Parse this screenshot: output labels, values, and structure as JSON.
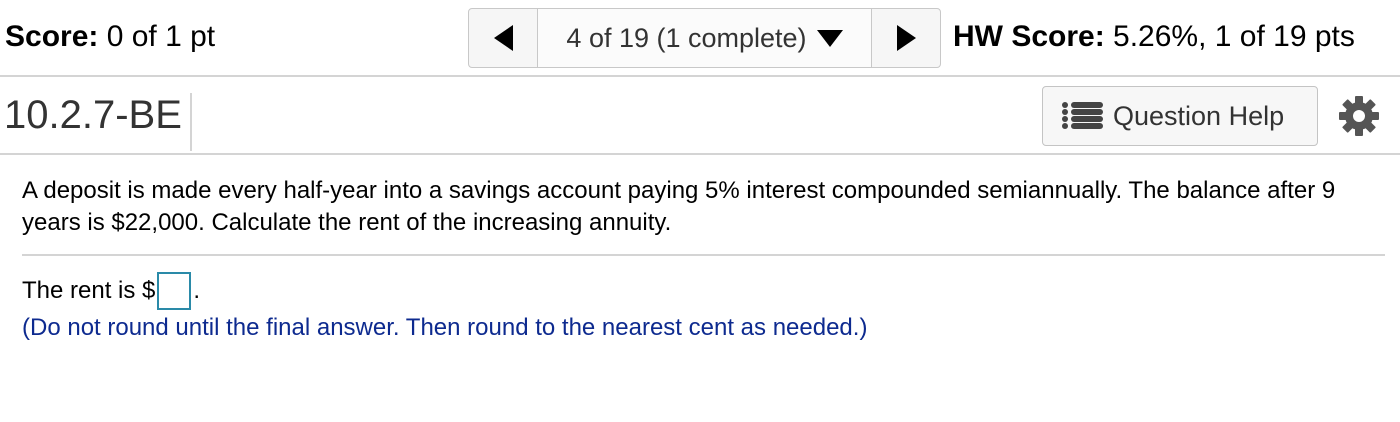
{
  "header": {
    "score_label": "Score:",
    "score_value": "0 of 1 pt",
    "nav_position": "4 of 19 (1 complete)",
    "hw_score_label": "HW Score:",
    "hw_score_value": "5.26%, 1 of 19 pts"
  },
  "question": {
    "id": "10.2.7-BE",
    "help_label": "Question Help",
    "text": "A deposit is made every half-year into a savings account paying 5% interest compounded semiannually. The balance after 9 years is $22,000. Calculate the rent of the increasing annuity.",
    "answer_prefix": "The rent is $",
    "answer_value": "",
    "answer_suffix": ".",
    "hint": "(Do not round until the final answer. Then round to the nearest cent as needed.)"
  },
  "colors": {
    "hint_text": "#0d2a8f",
    "answer_border": "#2a8aa8",
    "divider": "#d4d4d4"
  },
  "icons": [
    "triangle-left-icon",
    "triangle-down-icon",
    "triangle-right-icon",
    "list-icon",
    "gear-icon"
  ]
}
